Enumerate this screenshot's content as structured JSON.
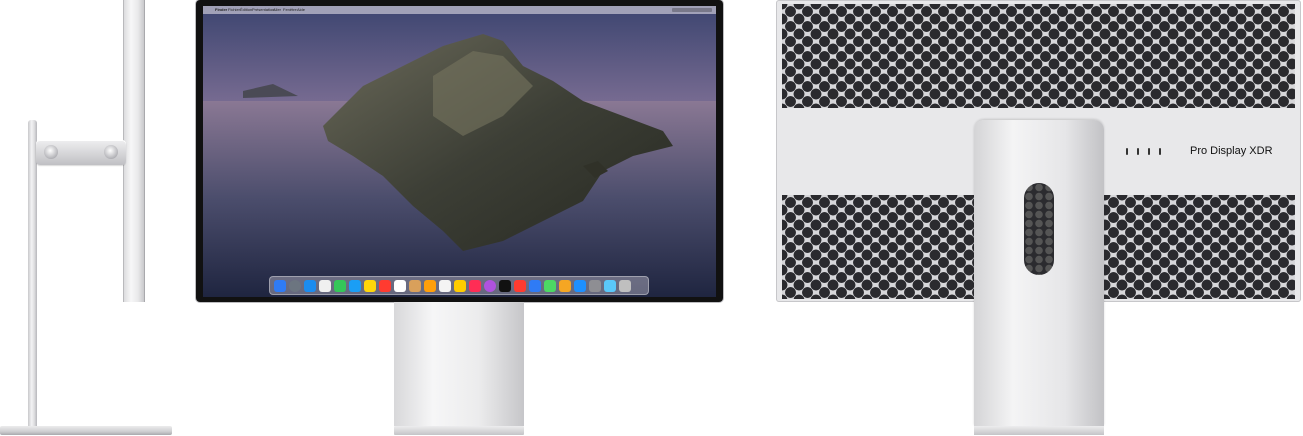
{
  "front": {
    "menubar": {
      "apple": "",
      "items": [
        "Finder",
        "Fichier",
        "Édition",
        "Présentation",
        "Aller",
        "Fenêtre",
        "Aide"
      ]
    },
    "dock_icons": [
      "#2f7bf5",
      "#6c7580",
      "#1b8cf0",
      "#f0f0f0",
      "#34c759",
      "#1a9ef5",
      "#ffd60a",
      "#ff3b30",
      "#ffffff",
      "#d9a05b",
      "#ff9f0a",
      "#f4f4f4",
      "#ffcc00",
      "#ff2d55",
      "#af52de",
      "#111111",
      "#ff3b30",
      "#2f7bf5",
      "#4cd964",
      "#f5a623",
      "#1e90ff",
      "#8e8e93",
      "#5ac8fa",
      "#bfbfbf"
    ]
  },
  "back": {
    "brand_logo": "",
    "brand_text": "Pro Display XDR"
  }
}
